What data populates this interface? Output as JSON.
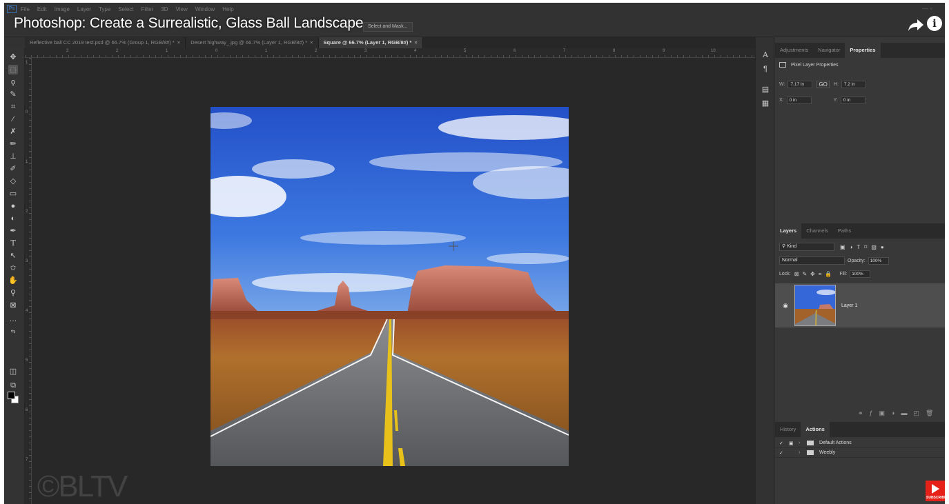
{
  "video": {
    "title": "Photoshop: Create a Surrealistic, Glass Ball Landscape",
    "watermark": "©BLTV"
  },
  "menubar": {
    "logo": "Ps",
    "items": [
      "File",
      "Edit",
      "Image",
      "Layer",
      "Type",
      "Select",
      "Filter",
      "3D",
      "View",
      "Window",
      "Help"
    ]
  },
  "optionsbar": {
    "select_mask_label": "Select and Mask..."
  },
  "tabs": [
    {
      "label": "Reflective ball CC 2019 test.psd @ 66.7% (Group 1, RGB/8#) *",
      "active": false
    },
    {
      "label": "Desert highway_.jpg @ 66.7% (Layer 1, RGB/8#) *",
      "active": false
    },
    {
      "label": "Square @ 66.7% (Layer 1, RGB/8#) *",
      "active": true
    }
  ],
  "ruler": {
    "top_labels": [
      "3",
      "2",
      "1",
      "0",
      "1",
      "2",
      "3",
      "4",
      "5",
      "6",
      "7",
      "8",
      "9",
      "10"
    ],
    "left_labels": [
      "1",
      "0",
      "1",
      "2",
      "3",
      "4",
      "5",
      "6",
      "7"
    ]
  },
  "properties_panel": {
    "tabs": [
      "Adjustments",
      "Navigator",
      "Properties"
    ],
    "active_tab": "Properties",
    "header": "Pixel Layer Properties",
    "w_label": "W:",
    "w_value": "7.17 in",
    "link_label": "GO",
    "h_label": "H:",
    "h_value": "7.2 in",
    "x_label": "X:",
    "x_value": "0 in",
    "y_label": "Y:",
    "y_value": "0 in"
  },
  "layers_panel": {
    "tabs": [
      "Layers",
      "Channels",
      "Paths"
    ],
    "active_tab": "Layers",
    "kind_label": "Kind",
    "blend_mode": "Normal",
    "opacity_label": "Opacity:",
    "opacity_value": "100%",
    "lock_label": "Lock:",
    "fill_label": "Fill:",
    "fill_value": "100%",
    "layers": [
      {
        "name": "Layer 1",
        "visible": true,
        "selected": true
      }
    ],
    "footer_icons": [
      "link-icon",
      "fx-icon",
      "mask-icon",
      "adjustment-icon",
      "group-icon",
      "new-layer-icon",
      "delete-icon"
    ]
  },
  "actions_panel": {
    "tabs": [
      "History",
      "Actions"
    ],
    "active_tab": "Actions",
    "items": [
      {
        "name": "Default Actions"
      },
      {
        "name": "Weebly"
      }
    ]
  },
  "tools": [
    "move-tool",
    "marquee-tool",
    "lasso-tool",
    "quick-select-tool",
    "crop-tool",
    "eyedropper-tool",
    "healing-tool",
    "brush-tool",
    "clone-stamp-tool",
    "history-brush-tool",
    "eraser-tool",
    "gradient-tool",
    "blur-tool",
    "dodge-tool",
    "pen-tool",
    "type-tool",
    "path-select-tool",
    "shape-tool",
    "hand-tool",
    "zoom-tool",
    "frame-tool",
    "more-tools"
  ],
  "colors": {
    "foreground": "#000000",
    "background": "#ffffff",
    "accent": "#3a6fb0",
    "subscribe": "#e62117"
  }
}
